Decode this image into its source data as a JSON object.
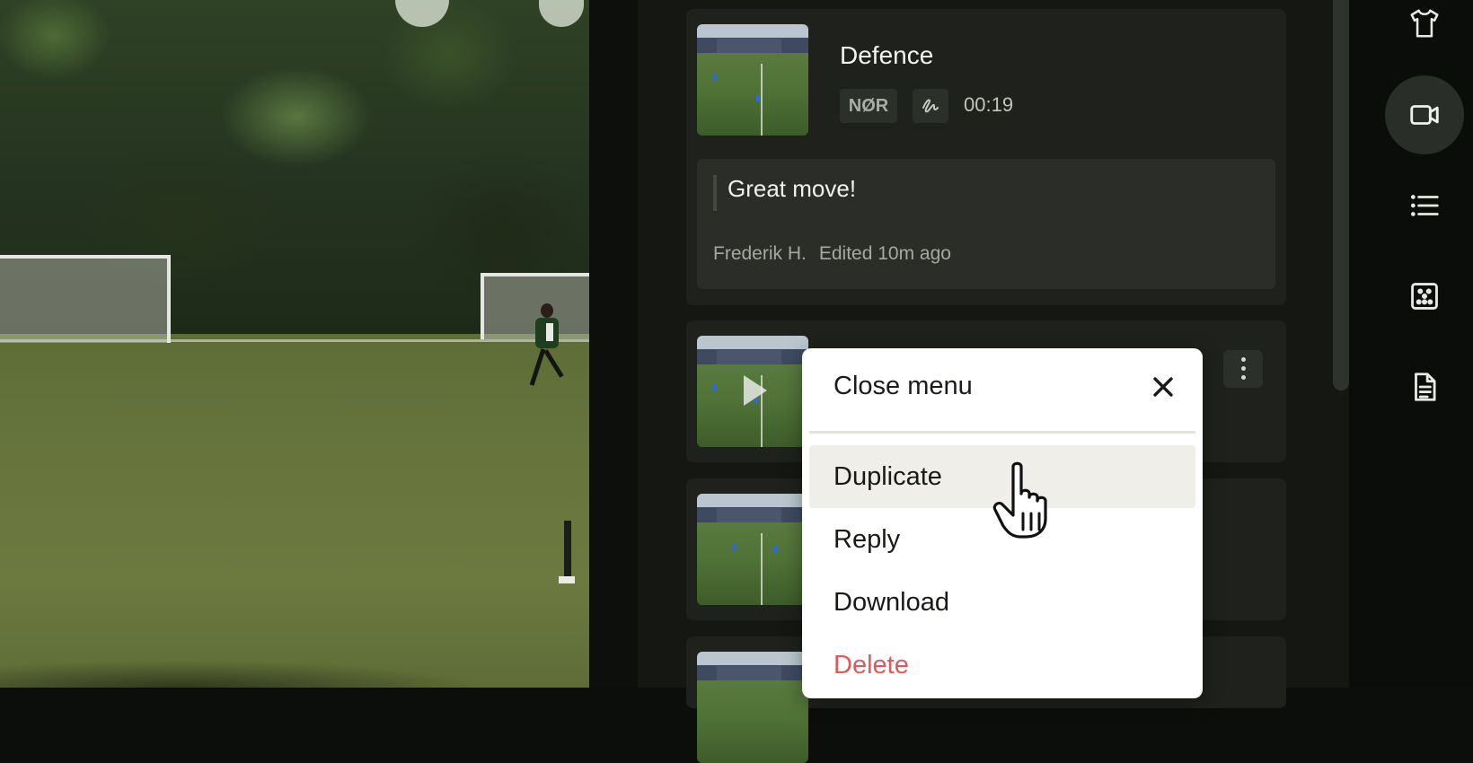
{
  "clips": [
    {
      "title": "Defence",
      "team_tag": "NØR",
      "drawing_tag_icon": "scribble-icon",
      "duration": "00:19",
      "comment": {
        "text": "Great move!",
        "author": "Frederik H.",
        "edited": "Edited 10m ago"
      }
    }
  ],
  "context_menu": {
    "header": "Close menu",
    "close_icon": "close-icon",
    "items": [
      {
        "label": "Duplicate",
        "state": "hover"
      },
      {
        "label": "Reply"
      },
      {
        "label": "Download"
      },
      {
        "label": "Delete",
        "color": "#e2585a"
      }
    ]
  },
  "rail": {
    "items": [
      {
        "icon": "shirt-icon"
      },
      {
        "icon": "video-camera-icon",
        "active": true
      },
      {
        "icon": "list-icon"
      },
      {
        "icon": "dice-formation-icon"
      },
      {
        "icon": "document-icon"
      }
    ]
  },
  "colors": {
    "panel_bg": "#141712",
    "card_bg": "#1e211c",
    "delete_red": "#e2585a",
    "menu_bg": "#ffffff"
  }
}
